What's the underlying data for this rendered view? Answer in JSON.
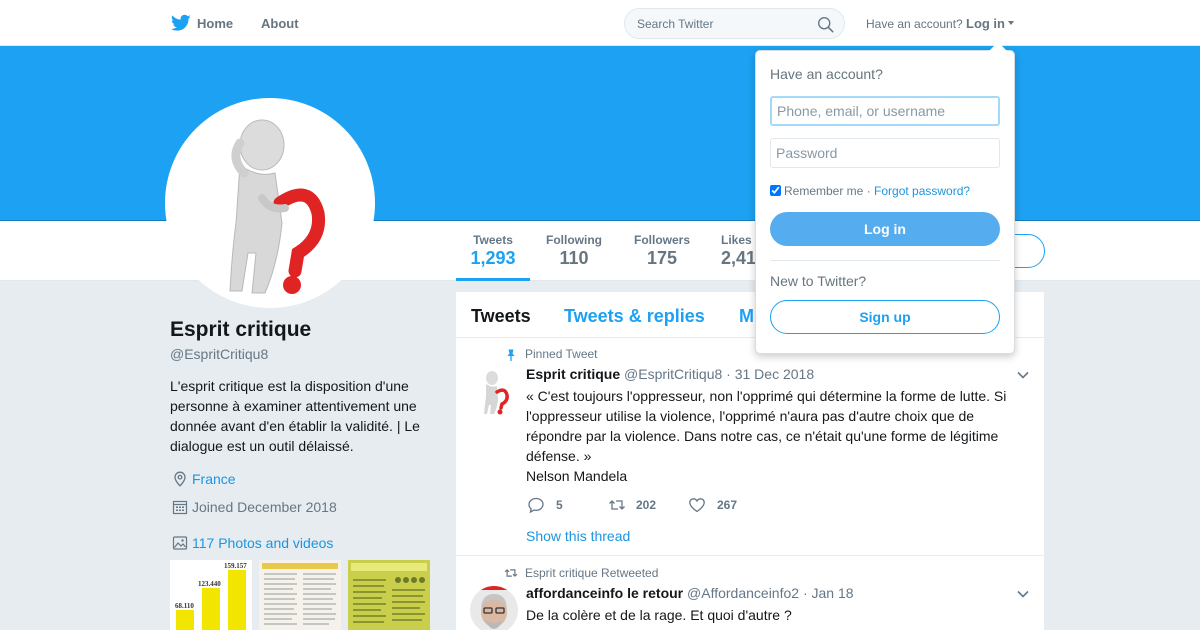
{
  "nav": {
    "home": "Home",
    "about": "About",
    "search_placeholder": "Search Twitter",
    "have_account": "Have an account?",
    "login": "Log in"
  },
  "profile": {
    "name": "Esprit critique",
    "handle": "@EspritCritiqu8",
    "bio": "L'esprit critique est la disposition d'une personne à examiner attentivement une donnée avant d'en établir la validité. | Le dialogue est un outil délaissé.",
    "location": "France",
    "joined": "Joined December 2018",
    "photos_link": "117 Photos and videos"
  },
  "stats": [
    {
      "label": "Tweets",
      "value": "1,293"
    },
    {
      "label": "Following",
      "value": "110"
    },
    {
      "label": "Followers",
      "value": "175"
    },
    {
      "label": "Likes",
      "value": "2,41"
    }
  ],
  "thumbnails": {
    "chart_values": [
      "68.110",
      "123.440",
      "159.157"
    ]
  },
  "timeline": {
    "tabs": [
      "Tweets",
      "Tweets & replies",
      "M"
    ],
    "tweets": [
      {
        "context": "Pinned Tweet",
        "name": "Esprit critique",
        "handle": "@EspritCritiqu8",
        "date": "· 31 Dec 2018",
        "text": "« C'est toujours l'oppresseur, non l'opprimé qui détermine la forme de lutte. Si l'oppresseur utilise la violence, l'opprimé n'aura pas d'autre choix que de répondre par la violence. Dans notre cas, ce n'était qu'une forme de légitime défense. »",
        "text2": "Nelson Mandela",
        "replies": "5",
        "retweets": "202",
        "likes": "267",
        "show_thread": "Show this thread"
      },
      {
        "context": "Esprit critique Retweeted",
        "name": "affordanceinfo le retour",
        "handle": "@Affordanceinfo2",
        "date": "· Jan 18",
        "text": "De la colère et de la rage. Et quoi d'autre ?"
      }
    ]
  },
  "login_dropdown": {
    "title": "Have an account?",
    "username_placeholder": "Phone, email, or username",
    "password_placeholder": "Password",
    "remember_me": "Remember me",
    "separator": " · ",
    "forgot": "Forgot password?",
    "login_button": "Log in",
    "new_to_twitter": "New to Twitter?",
    "signup_button": "Sign up"
  },
  "colors": {
    "brand": "#1da1f2",
    "link": "#1b95e0",
    "login_button": "#55acee"
  }
}
